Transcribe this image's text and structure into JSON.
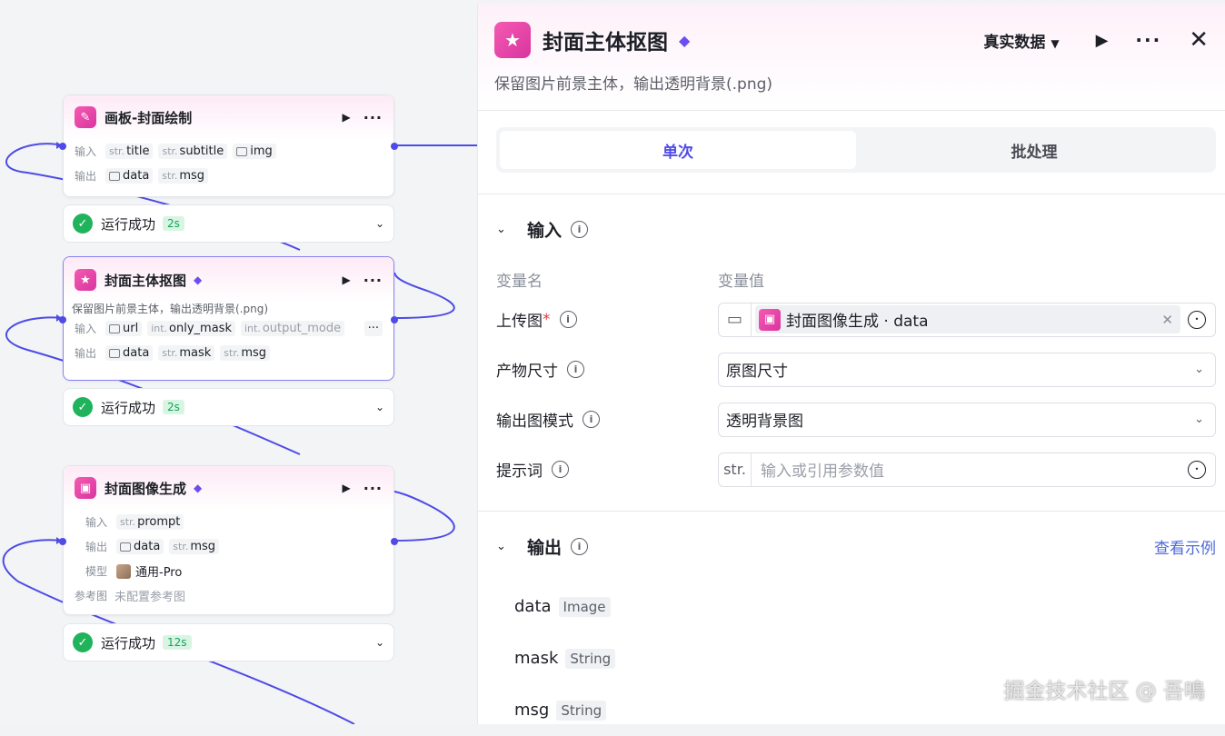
{
  "canvas": {
    "nodes": [
      {
        "title": "画板-封面绘制",
        "io_input_label": "输入",
        "io_output_label": "输出",
        "inputs": [
          {
            "type": "str.",
            "name": "title"
          },
          {
            "type": "str.",
            "name": "subtitle"
          },
          {
            "type": "img",
            "name": "img"
          }
        ],
        "outputs": [
          {
            "type": "img",
            "name": "data"
          },
          {
            "type": "str.",
            "name": "msg"
          }
        ]
      },
      {
        "title": "封面主体抠图",
        "desc": "保留图片前景主体，输出透明背景(.png)",
        "io_input_label": "输入",
        "io_output_label": "输出",
        "inputs": [
          {
            "type": "img",
            "name": "url"
          },
          {
            "type": "int.",
            "name": "only_mask"
          },
          {
            "type": "int.",
            "name": "output_mode"
          }
        ],
        "inputs_more": "···",
        "outputs": [
          {
            "type": "img",
            "name": "data"
          },
          {
            "type": "str.",
            "name": "mask"
          },
          {
            "type": "str.",
            "name": "msg"
          }
        ]
      },
      {
        "title": "封面图像生成",
        "io_input_label": "输入",
        "io_output_label": "输出",
        "model_label": "模型",
        "ref_label": "参考图",
        "inputs": [
          {
            "type": "str.",
            "name": "prompt"
          }
        ],
        "outputs": [
          {
            "type": "img",
            "name": "data"
          },
          {
            "type": "str.",
            "name": "msg"
          }
        ],
        "model": "通用-Pro",
        "ref": "未配置参考图"
      }
    ],
    "statuses": [
      {
        "text": "运行成功",
        "duration": "2s"
      },
      {
        "text": "运行成功",
        "duration": "2s"
      },
      {
        "text": "运行成功",
        "duration": "12s"
      }
    ]
  },
  "panel": {
    "title": "封面主体抠图",
    "description": "保留图片前景主体，输出透明背景(.png)",
    "data_mode": "真实数据",
    "tabs": [
      "单次",
      "批处理"
    ],
    "active_tab": 0,
    "input_section": {
      "title": "输入",
      "col_name": "变量名",
      "col_value": "变量值",
      "fields": [
        {
          "label": "上传图",
          "required": "*",
          "ref_text": "封面图像生成 · data"
        },
        {
          "label": "产物尺寸",
          "value": "原图尺寸"
        },
        {
          "label": "输出图模式",
          "value": "透明背景图"
        },
        {
          "label": "提示词",
          "prefix": "str.",
          "placeholder": "输入或引用参数值"
        }
      ]
    },
    "output_section": {
      "title": "输出",
      "link": "查看示例",
      "outputs": [
        {
          "name": "data",
          "type": "Image"
        },
        {
          "name": "mask",
          "type": "String"
        },
        {
          "name": "msg",
          "type": "String"
        }
      ]
    }
  },
  "watermark": "掘金技术社区 @ 吾鳴",
  "colors": {
    "accent": "#4e4be6",
    "brand_pink": "#e9479f",
    "success": "#1fb35c",
    "link": "#4e6bd8"
  }
}
